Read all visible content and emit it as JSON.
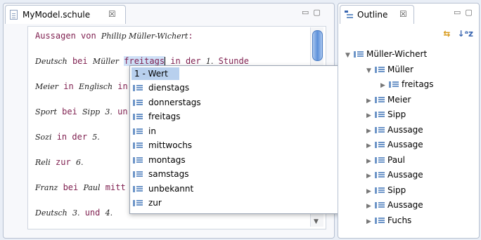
{
  "editor": {
    "tab_title": "MyModel.schule",
    "close_glyph": "☒",
    "lines": [
      {
        "parts": [
          {
            "t": "Aussagen von ",
            "c": "kw"
          },
          {
            "t": "Phillip Müller-Wichert",
            "c": "it"
          },
          {
            "t": ":",
            "c": "kw"
          }
        ]
      },
      {
        "parts": [
          {
            "t": "Deutsch",
            "c": "it"
          },
          {
            "t": " bei ",
            "c": "kw"
          },
          {
            "t": "Müller",
            "c": "it"
          },
          {
            "t": " ",
            "c": ""
          },
          {
            "t": "freitags",
            "c": "hl"
          },
          {
            "t": "|",
            "c": "caret"
          },
          {
            "t": " in der ",
            "c": "kw"
          },
          {
            "t": "1.",
            "c": "it"
          },
          {
            "t": " Stunde",
            "c": "kw"
          }
        ]
      },
      {
        "parts": [
          {
            "t": "Meier",
            "c": "it"
          },
          {
            "t": " in ",
            "c": "kw"
          },
          {
            "t": "Englisch",
            "c": "it"
          },
          {
            "t": " in",
            "c": "kw"
          }
        ]
      },
      {
        "parts": [
          {
            "t": "Sport",
            "c": "it"
          },
          {
            "t": " bei ",
            "c": "kw"
          },
          {
            "t": "Sipp",
            "c": "it"
          },
          {
            "t": " ",
            "c": ""
          },
          {
            "t": "3.",
            "c": "it"
          },
          {
            "t": " un",
            "c": "kw"
          }
        ]
      },
      {
        "parts": [
          {
            "t": "Sozi",
            "c": "it"
          },
          {
            "t": " in der ",
            "c": "kw"
          },
          {
            "t": "5.",
            "c": "it"
          }
        ]
      },
      {
        "parts": [
          {
            "t": "Reli",
            "c": "it"
          },
          {
            "t": " zur ",
            "c": "kw"
          },
          {
            "t": "6.",
            "c": "it"
          }
        ]
      },
      {
        "parts": [
          {
            "t": "Franz",
            "c": "it"
          },
          {
            "t": " bei ",
            "c": "kw"
          },
          {
            "t": "Paul",
            "c": "it"
          },
          {
            "t": " mitt",
            "c": "kw"
          }
        ]
      },
      {
        "parts": [
          {
            "t": "Deutsch",
            "c": "it"
          },
          {
            "t": " ",
            "c": ""
          },
          {
            "t": "3.",
            "c": "it"
          },
          {
            "t": " und ",
            "c": "kw"
          },
          {
            "t": "4.",
            "c": "it"
          }
        ]
      }
    ]
  },
  "content_assist": {
    "header": "1 - Wert",
    "items": [
      "dienstags",
      "donnerstags",
      "freitags",
      "in",
      "mittwochs",
      "montags",
      "samstags",
      "unbekannt",
      "zur"
    ],
    "item_icon": "list-icon"
  },
  "outline": {
    "tab_title": "Outline",
    "close_glyph": "☒",
    "tree": [
      {
        "label": "Müller-Wichert",
        "level": 0,
        "toggle": "▼"
      },
      {
        "label": "Müller",
        "level": 1,
        "toggle": "▼"
      },
      {
        "label": "freitags",
        "level": 2,
        "toggle": "▶"
      },
      {
        "label": "Meier",
        "level": 1,
        "toggle": "▶"
      },
      {
        "label": "Sipp",
        "level": 1,
        "toggle": "▶"
      },
      {
        "label": "Aussage",
        "level": 1,
        "toggle": "▶"
      },
      {
        "label": "Aussage",
        "level": 1,
        "toggle": "▶"
      },
      {
        "label": "Paul",
        "level": 1,
        "toggle": "▶"
      },
      {
        "label": "Aussage",
        "level": 1,
        "toggle": "▶"
      },
      {
        "label": "Sipp",
        "level": 1,
        "toggle": "▶"
      },
      {
        "label": "Aussage",
        "level": 1,
        "toggle": "▶"
      },
      {
        "label": "Fuchs",
        "level": 1,
        "toggle": "▶"
      }
    ]
  },
  "window_controls": {
    "minimize": "▭",
    "maximize": "▢"
  },
  "colors": {
    "keyword": "#7f1f4f",
    "selection": "#b8d0ee",
    "icon": "#6d95c8"
  }
}
